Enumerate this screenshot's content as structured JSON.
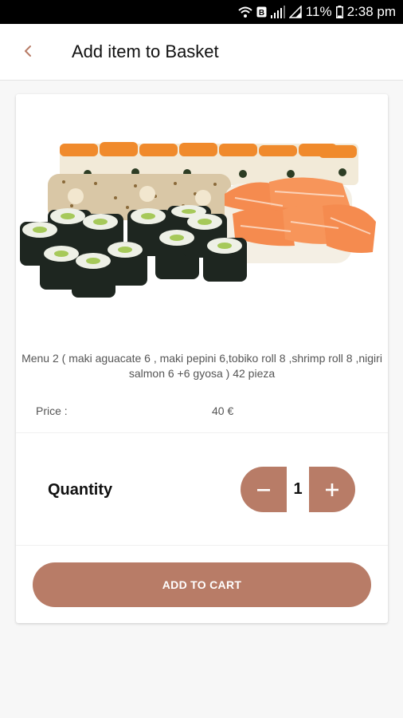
{
  "status_bar": {
    "battery": "11%",
    "time": "2:38 pm"
  },
  "app_bar": {
    "title": "Add item to Basket",
    "back_icon": "chevron-left-icon"
  },
  "product": {
    "image": "sushi-platter-photo",
    "description": "Menu 2 ( maki aguacate 6 , maki pepini 6,tobiko roll 8 ,shrimp roll 8 ,nigiri salmon 6 +6 gyosa ) 42 pieza",
    "price_label": "Price :",
    "price_value": "40 €"
  },
  "quantity": {
    "label": "Quantity",
    "value": "1",
    "decrement_icon": "minus-icon",
    "increment_icon": "plus-icon"
  },
  "actions": {
    "add_to_cart": "ADD TO CART"
  },
  "colors": {
    "accent": "#b87c67",
    "status_bar": "#000000",
    "background": "#f7f7f7"
  }
}
